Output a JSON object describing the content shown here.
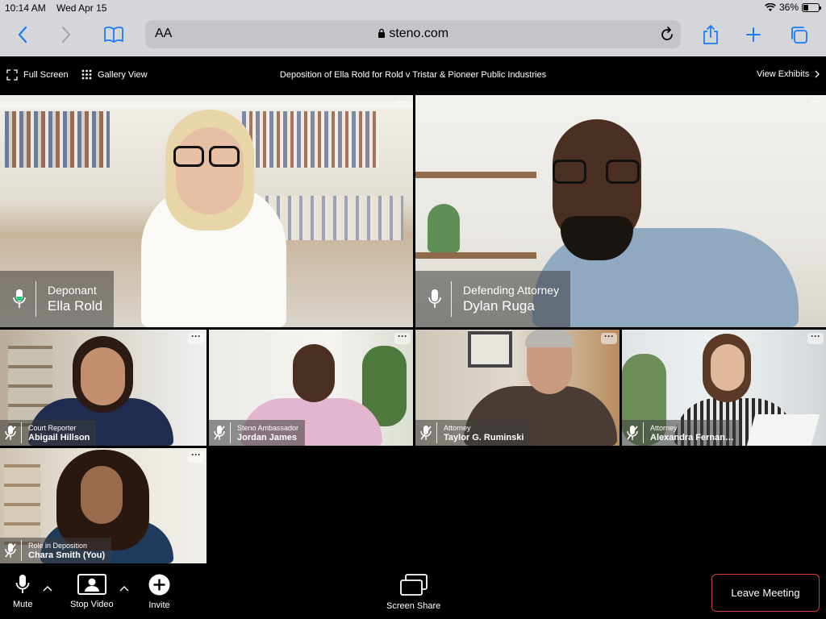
{
  "status_bar": {
    "time": "10:14 AM",
    "date": "Wed Apr 15",
    "battery": "36%",
    "battery_level": 0.36
  },
  "browser": {
    "aa_label": "AA",
    "url": "steno.com"
  },
  "meeting": {
    "full_screen_label": "Full Screen",
    "gallery_view_label": "Gallery View",
    "title": "Deposition of Ella Rold for Rold v Tristar & Pioneer Public Industries",
    "view_exhibits_label": "View Exhibits"
  },
  "participants": [
    {
      "role": "Deponant",
      "name": "Ella Rold",
      "active": true
    },
    {
      "role": "Defending Attorney",
      "name": "Dylan Ruga"
    },
    {
      "role": "Court Reporter",
      "name": "Abigail Hillson",
      "muted": true
    },
    {
      "role": "Steno Ambassador",
      "name": "Jordan James",
      "muted": true
    },
    {
      "role": "Attorney",
      "name": "Taylor G. Ruminski",
      "muted": true
    },
    {
      "role": "Attorney",
      "name": "Alexandra Fernan…",
      "muted": true
    },
    {
      "role": "Role in Deposition",
      "name": "Chara Smith (You)",
      "muted": true
    }
  ],
  "more_label": "···",
  "controls": {
    "mute_label": "Mute",
    "stop_video_label": "Stop Video",
    "invite_label": "Invite",
    "screen_share_label": "Screen Share",
    "leave_label": "Leave Meeting"
  },
  "colors": {
    "active_speaker": "#1ec97a",
    "leave_border": "#d33c3c",
    "browser_chrome": "#d5d6d9",
    "accent_blue": "#1a7cf5"
  }
}
